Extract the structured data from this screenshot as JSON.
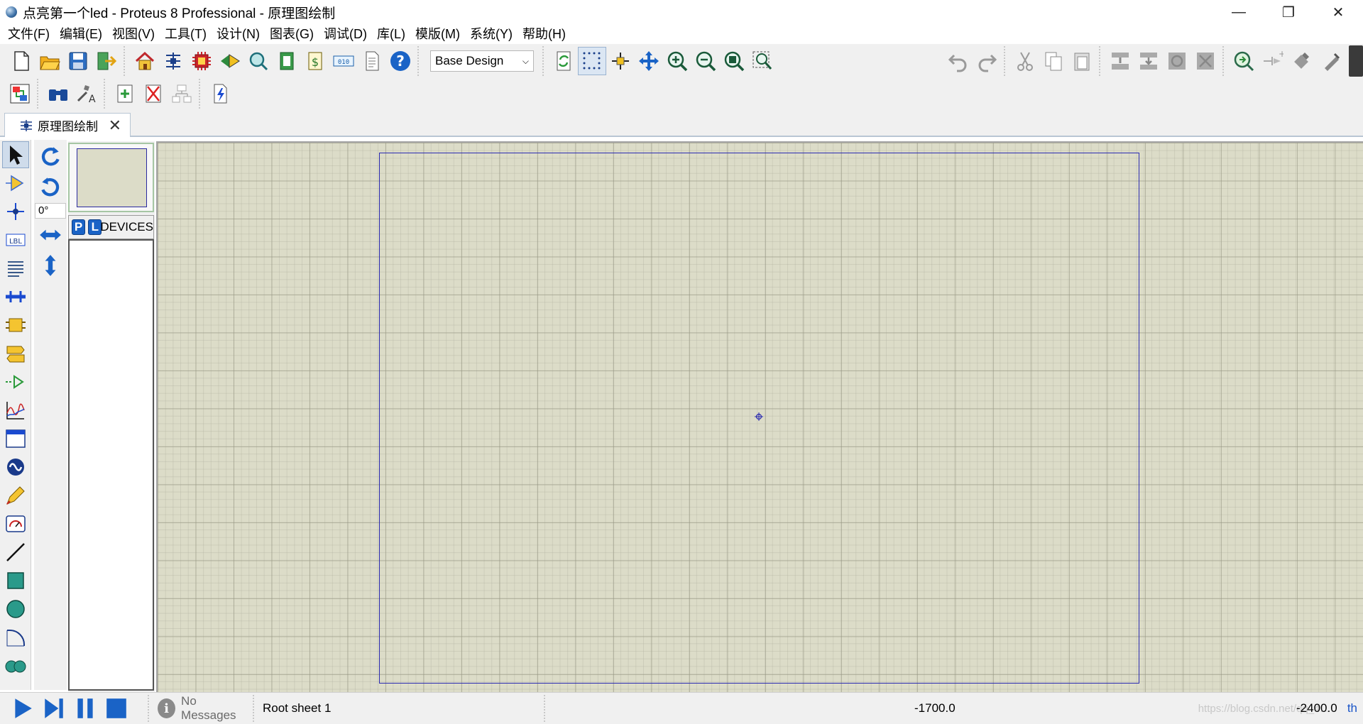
{
  "window": {
    "title": "点亮第一个led - Proteus 8 Professional - 原理图绘制",
    "minimize": "—",
    "restore": "❐",
    "close": "✕"
  },
  "menu": [
    "文件(F)",
    "编辑(E)",
    "视图(V)",
    "工具(T)",
    "设计(N)",
    "图表(G)",
    "调试(D)",
    "库(L)",
    "模版(M)",
    "系统(Y)",
    "帮助(H)"
  ],
  "toolbar": {
    "variant_select": "Base Design"
  },
  "tab": {
    "label": "原理图绘制",
    "close": "✕"
  },
  "rotation": {
    "angle": "0°"
  },
  "devices": {
    "pick_button": "P",
    "library_button": "L",
    "label": "DEVICES"
  },
  "status": {
    "messages": "No Messages",
    "sheet": "Root sheet 1",
    "x_coord": "-1700.0",
    "y_coord": "-2400.0",
    "unit": "th",
    "watermark": "https://blog.csdn.net/qq_4..."
  },
  "colors": {
    "canvas": "#dcdcc8",
    "sheet_border": "#2a2ab0",
    "accent_blue": "#1a63c6"
  }
}
